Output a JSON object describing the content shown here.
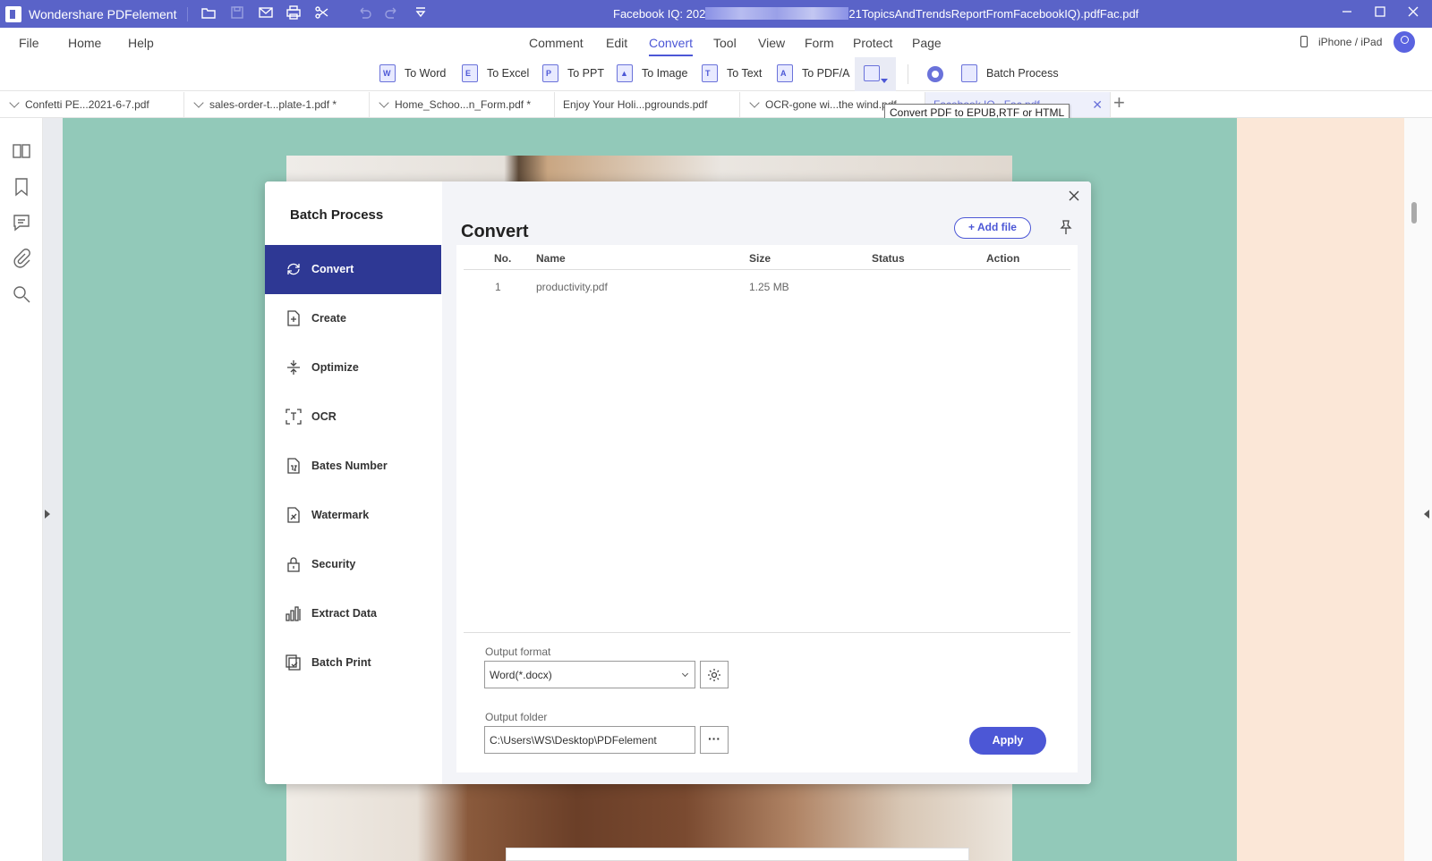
{
  "titlebar": {
    "app_name": "Wondershare PDFelement",
    "doc_title_left": "Facebook IQ: 202",
    "doc_title_right": "21TopicsAndTrendsReportFromFacebookIQ).pdfFac.pdf"
  },
  "menu": {
    "file": "File",
    "home": "Home",
    "help": "Help",
    "items": [
      "Comment",
      "Edit",
      "Convert",
      "Tool",
      "View",
      "Form",
      "Protect",
      "Page"
    ],
    "active": "Convert",
    "device": "iPhone / iPad"
  },
  "toolbar": {
    "tools": [
      {
        "label": "To Word",
        "glyph": "W"
      },
      {
        "label": "To Excel",
        "glyph": "E"
      },
      {
        "label": "To PPT",
        "glyph": "P"
      },
      {
        "label": "To Image",
        "glyph": "▲"
      },
      {
        "label": "To Text",
        "glyph": "T"
      },
      {
        "label": "To PDF/A",
        "glyph": "A"
      }
    ],
    "batch_process": "Batch Process"
  },
  "tabs": [
    {
      "label": "Confetti PE...2021-6-7.pdf"
    },
    {
      "label": "sales-order-t...plate-1.pdf *"
    },
    {
      "label": "Home_Schoo...n_Form.pdf *"
    },
    {
      "label": "Enjoy Your Holi...pgrounds.pdf"
    },
    {
      "label": "OCR-gone wi...the wind.pdf"
    },
    {
      "label": "Facebook IQ...Fac.pdf"
    }
  ],
  "tooltip": "Convert PDF to EPUB,RTF or HTML",
  "modal": {
    "title": "Batch Process",
    "nav": [
      {
        "label": "Convert",
        "icon": "refresh-icon"
      },
      {
        "label": "Create",
        "icon": "create-icon"
      },
      {
        "label": "Optimize",
        "icon": "optimize-icon"
      },
      {
        "label": "OCR",
        "icon": "ocr-icon"
      },
      {
        "label": "Bates Number",
        "icon": "bates-icon"
      },
      {
        "label": "Watermark",
        "icon": "watermark-icon"
      },
      {
        "label": "Security",
        "icon": "lock-icon"
      },
      {
        "label": "Extract Data",
        "icon": "chart-icon"
      },
      {
        "label": "Batch Print",
        "icon": "print-icon"
      }
    ],
    "active_nav": "Convert",
    "heading": "Convert",
    "add_file": "Add file",
    "table": {
      "columns": [
        "No.",
        "Name",
        "Size",
        "Status",
        "Action"
      ],
      "rows": [
        {
          "no": "1",
          "name": "productivity.pdf",
          "size": "1.25 MB",
          "status": "",
          "action": ""
        }
      ]
    },
    "output_format_label": "Output format",
    "output_format_value": "Word(*.docx)",
    "output_folder_label": "Output folder",
    "output_folder_value": "C:\\Users\\WS\\Desktop\\PDFelement",
    "apply": "Apply"
  },
  "colors": {
    "accent": "#4c57d6",
    "titlebar": "#5a63c8",
    "nav_active": "#2e3894",
    "page_bg": "#92c9b9"
  }
}
